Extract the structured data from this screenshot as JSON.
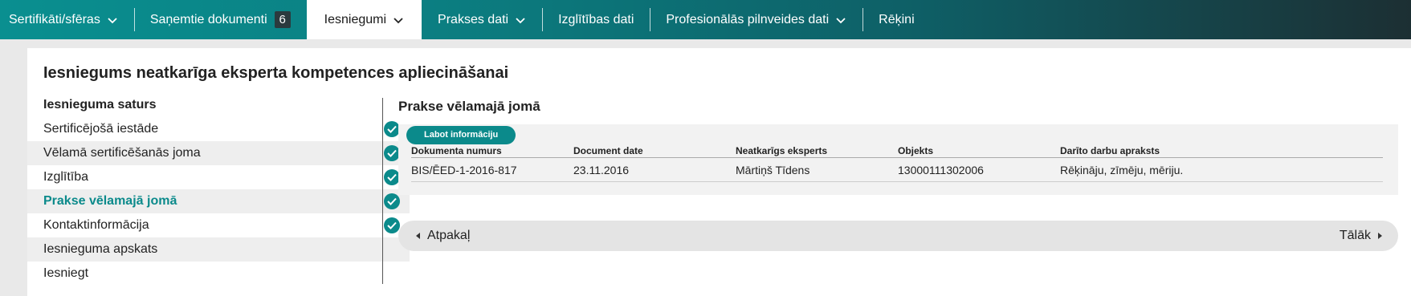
{
  "nav": {
    "items": [
      {
        "label": "Sertifikāti/sfēras",
        "has_dropdown": true
      },
      {
        "label": "Saņemtie dokumenti",
        "badge": "6"
      },
      {
        "label": "Iesniegumi",
        "has_dropdown": true,
        "active": true
      },
      {
        "label": "Prakses dati",
        "has_dropdown": true
      },
      {
        "label": "Izglītības dati"
      },
      {
        "label": "Profesionālās pilnveides dati",
        "has_dropdown": true
      },
      {
        "label": "Rēķini"
      }
    ]
  },
  "page": {
    "title": "Iesniegums neatkarīga eksperta kompetences apliecināšanai"
  },
  "sidebar": {
    "heading": "Iesnieguma saturs",
    "items": [
      {
        "label": "Sertificējošā iestāde",
        "completed": true
      },
      {
        "label": "Vēlamā sertificēšanās joma",
        "completed": true
      },
      {
        "label": "Izglītība",
        "completed": true
      },
      {
        "label": "Prakse vēlamajā jomā",
        "completed": true,
        "current": true
      },
      {
        "label": "Kontaktinformācija",
        "completed": true
      },
      {
        "label": "Iesnieguma apskats",
        "completed": false
      },
      {
        "label": "Iesniegt",
        "completed": false
      }
    ]
  },
  "section": {
    "title": "Prakse vēlamajā jomā",
    "edit_label": "Labot informāciju",
    "columns": [
      "Dokumenta numurs",
      "Document date",
      "Neatkarīgs eksperts",
      "Objekts",
      "Darīto darbu apraksts"
    ],
    "rows": [
      [
        "BIS/ĒED-1-2016-817",
        "23.11.2016",
        "Mārtiņš Tīdens",
        "13000111302006",
        "Rēķināju, zīmēju, mēriju."
      ]
    ]
  },
  "pager": {
    "back_label": "Atpakaļ",
    "next_label": "Tālāk"
  },
  "colors": {
    "accent": "#0b8a8b",
    "nav_gradient_start": "#0a8f90",
    "nav_gradient_end": "#1c2f33"
  },
  "icons": {
    "check": "check-circle-icon",
    "dropdown": "chevron-down-icon"
  }
}
